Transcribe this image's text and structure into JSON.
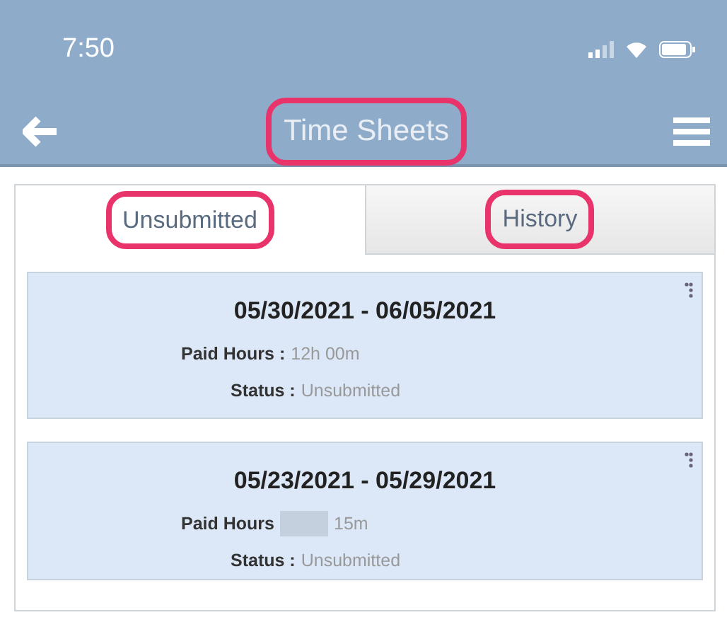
{
  "status_bar": {
    "time": "7:50"
  },
  "header": {
    "title": "Time Sheets",
    "title_highlighted": true
  },
  "tabs": [
    {
      "label": "Unsubmitted",
      "selected": true,
      "highlighted": true
    },
    {
      "label": "History",
      "selected": false,
      "highlighted": true
    }
  ],
  "timesheets": [
    {
      "period": "05/30/2021 - 06/05/2021",
      "paid_hours_label": "Paid Hours :",
      "paid_hours": "12h 00m",
      "paid_hours_redacted": false,
      "status_label": "Status :",
      "status": "Unsubmitted"
    },
    {
      "period": "05/23/2021 - 05/29/2021",
      "paid_hours_label": "Paid Hours",
      "paid_hours": "15m",
      "paid_hours_redacted": true,
      "status_label": "Status :",
      "status": "Unsubmitted"
    }
  ]
}
